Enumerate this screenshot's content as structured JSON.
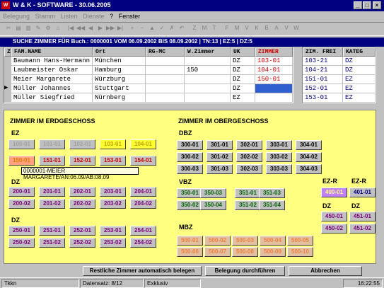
{
  "window": {
    "title": "W & K - SOFTWARE - 30.06.2005",
    "min": "_",
    "max": "□",
    "close": "×"
  },
  "menu": [
    "Belegung",
    "Stamm",
    "Listen",
    "Dienste",
    "?",
    "Fenster"
  ],
  "toolbar": [
    "✂",
    "▤",
    "▥",
    "✎",
    "⚙",
    "⌂",
    "|◀",
    "◀◀",
    "◀",
    "▶",
    "▶▶",
    "▶|",
    "+",
    "−",
    "▲",
    "✓",
    "✗",
    "↶",
    "Z",
    "M",
    "T",
    "F",
    "M",
    "V",
    "K",
    "B",
    "A",
    "V",
    "W"
  ],
  "search": {
    "title": "SUCHE ZIMMER FÜR Buch.: 0000001 VOM 06.09.2002 BIS 08.09.2002 | TN:13 | EZ:5 | DZ:5"
  },
  "grid": {
    "headers": [
      "Z",
      "FAM.NAME",
      "Ort",
      "RG-MC",
      "W.Zimmer",
      "UK",
      "ZIMMER"
    ],
    "rows": [
      {
        "mark": "",
        "name": "Baumann Hans-Hermann",
        "ort": "München",
        "rg": "",
        "wz": "",
        "uk": "DZ",
        "zim": "103-01"
      },
      {
        "mark": "",
        "name": "Laubmeister Oskar",
        "ort": "Hamburg",
        "rg": "",
        "wz": "150",
        "uk": "DZ",
        "zim": "104-01"
      },
      {
        "mark": "",
        "name": "Meier Margarete",
        "ort": "Würzburg",
        "rg": "",
        "wz": "",
        "uk": "DZ",
        "zim": "150-01"
      },
      {
        "mark": "▶",
        "name": "Müller Johannes",
        "ort": "Stuttgart",
        "rg": "",
        "wz": "",
        "uk": "DZ",
        "zim": ""
      },
      {
        "mark": "",
        "name": "Müller Siegfried",
        "ort": "Nürnberg",
        "rg": "",
        "wz": "",
        "uk": "EZ",
        "zim": ""
      }
    ]
  },
  "grid2": {
    "headers": [
      "ZIM. FREI",
      "KATEG"
    ],
    "rows": [
      [
        "103-21",
        "DZ"
      ],
      [
        "104-21",
        "DZ"
      ],
      [
        "151-01",
        "EZ"
      ],
      [
        "152-01",
        "EZ"
      ],
      [
        "153-01",
        "EZ"
      ]
    ]
  },
  "erd": {
    "title": "ZIMMER IM ERDGESCHOSS",
    "ez": "EZ",
    "dz": "DZ",
    "dz2": "DZ",
    "ez_r1": [
      "100-01",
      "101-01",
      "102-01",
      "103-01",
      "104-01"
    ],
    "ez_r2": [
      "150-01",
      "151-01",
      "152-01",
      "153-01",
      "154-01"
    ],
    "dz_r1": [
      "200-01",
      "201-01",
      "202-01",
      "203-01",
      "204-01"
    ],
    "dz_r2": [
      "200-02",
      "201-02",
      "202-02",
      "203-02",
      "204-02"
    ],
    "dz2_r1": [
      "250-01",
      "251-01",
      "252-01",
      "253-01",
      "254-01"
    ],
    "dz2_r2": [
      "250-02",
      "251-02",
      "252-02",
      "253-02",
      "254-02"
    ]
  },
  "tooltip": "0000001-MEIER MARGARETE/AN:06.09/AB:08.09",
  "ober": {
    "title": "ZIMMER IM OBERGESCHOSS",
    "dbz": "DBZ",
    "vbz": "VBZ",
    "mbz": "MBZ",
    "ezr": "EZ-R",
    "ezr2": "EZ-R",
    "dz": "DZ",
    "dz2": "DZ",
    "dbz_r1": [
      "300-01",
      "301-01",
      "302-01",
      "303-01",
      "304-01"
    ],
    "dbz_r2": [
      "300-02",
      "301-02",
      "302-02",
      "303-02",
      "304-02"
    ],
    "dbz_r3": [
      "300-03",
      "301-03",
      "302-03",
      "303-03",
      "304-03"
    ],
    "vbz_r1": [
      "350-01",
      "350-03",
      "351-01",
      "351-03"
    ],
    "vbz_r2": [
      "350-02",
      "350-04",
      "351-02",
      "351-04"
    ],
    "mbz_r1": [
      "500-01",
      "500-02",
      "500-03",
      "500-04",
      "500-05"
    ],
    "mbz_r2": [
      "500-06",
      "500-07",
      "500-08",
      "500-09",
      "500-10"
    ],
    "ezr_a": "400-01",
    "ezr_b": "401-01",
    "dz_a1": "450-01",
    "dz_a2": "450-02",
    "dz_b1": "451-01",
    "dz_b2": "451-02"
  },
  "buttons": {
    "auto": "Restliche Zimmer automatisch belegen",
    "run": "Belegung durchführen",
    "cancel": "Abbrechen"
  },
  "status": {
    "a": "Tkkn",
    "b": "Datensatz: 8/12",
    "c": "Exklusiv",
    "time": "16:22:55"
  }
}
